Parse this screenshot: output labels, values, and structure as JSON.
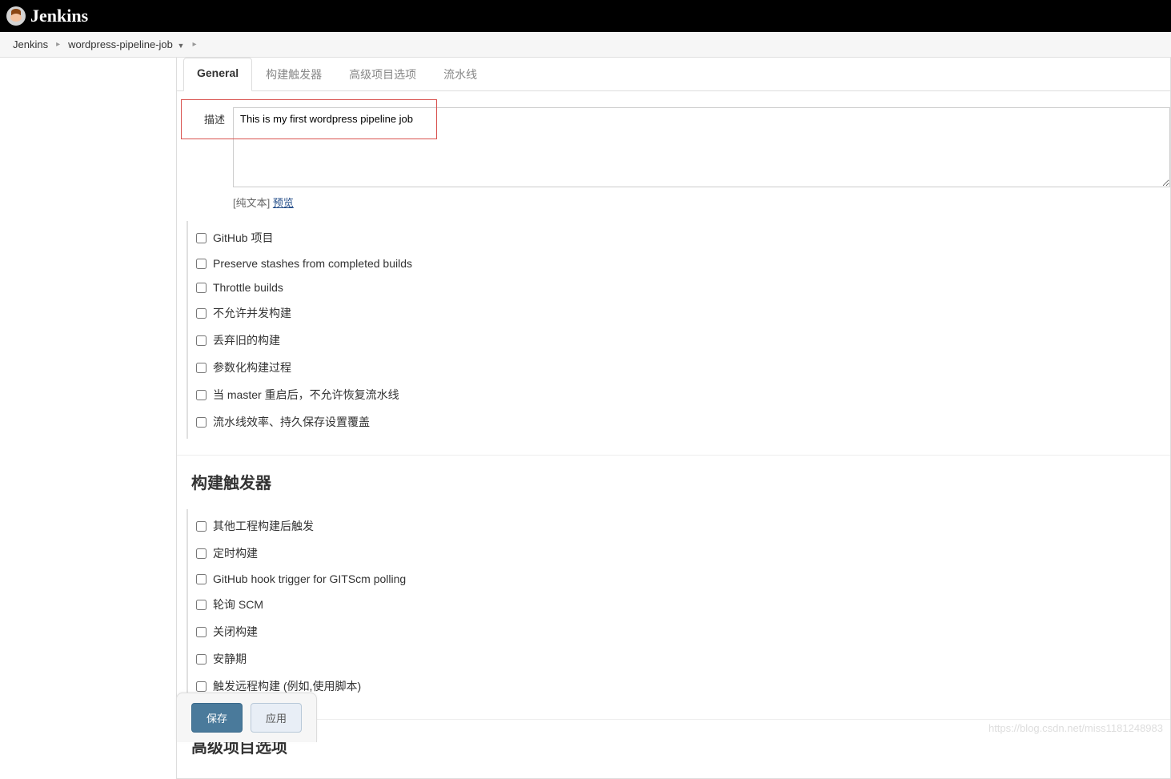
{
  "header": {
    "product_name": "Jenkins"
  },
  "breadcrumb": {
    "items": [
      "Jenkins",
      "wordpress-pipeline-job"
    ]
  },
  "tabs": {
    "items": [
      {
        "label": "General",
        "active": true
      },
      {
        "label": "构建触发器",
        "active": false
      },
      {
        "label": "高级项目选项",
        "active": false
      },
      {
        "label": "流水线",
        "active": false
      }
    ]
  },
  "description": {
    "label": "描述",
    "value": "This is my first wordpress pipeline job",
    "format_hint": "[纯文本]",
    "preview_link": "预览"
  },
  "general_options": [
    {
      "label": "GitHub 项目"
    },
    {
      "label": "Preserve stashes from completed builds"
    },
    {
      "label": "Throttle builds"
    },
    {
      "label": "不允许并发构建"
    },
    {
      "label": "丢弃旧的构建"
    },
    {
      "label": "参数化构建过程"
    },
    {
      "label": "当 master 重启后，不允许恢复流水线"
    },
    {
      "label": "流水线效率、持久保存设置覆盖"
    }
  ],
  "sections": {
    "triggers_heading": "构建触发器",
    "advanced_heading": "高级项目选项"
  },
  "trigger_options": [
    {
      "label": "其他工程构建后触发"
    },
    {
      "label": "定时构建"
    },
    {
      "label": "GitHub hook trigger for GITScm polling"
    },
    {
      "label": "轮询 SCM"
    },
    {
      "label": "关闭构建"
    },
    {
      "label": "安静期"
    },
    {
      "label": "触发远程构建 (例如,使用脚本)"
    }
  ],
  "buttons": {
    "save": "保存",
    "apply": "应用"
  },
  "watermark": "https://blog.csdn.net/miss1181248983"
}
